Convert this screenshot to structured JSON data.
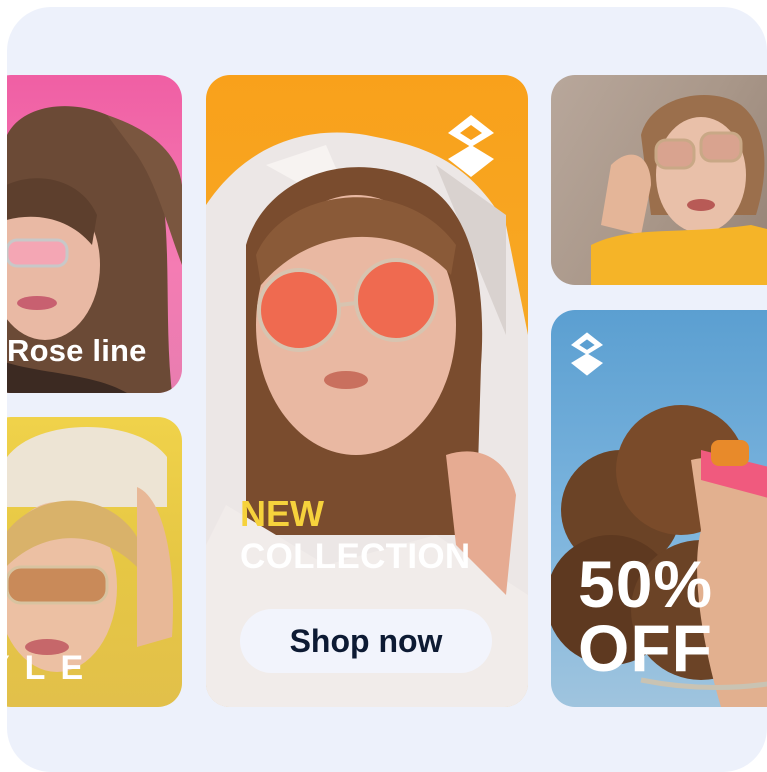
{
  "cards": [
    {
      "id": "rose",
      "label": "Rose line"
    },
    {
      "id": "collection",
      "new_text": "NEW",
      "collection_text": "COLLECTION",
      "button_label": "Shop now"
    },
    {
      "id": "model-top-right"
    },
    {
      "id": "sale",
      "percent_text": "50%",
      "off_text": "OFF"
    },
    {
      "id": "style",
      "label": "YLE"
    }
  ],
  "colors": {
    "background": "#edf1fb",
    "pink_card": "#f05fa4",
    "orange_card": "#f9a11b",
    "brown_card": "#a99789",
    "blue_card": "#5b9fd1",
    "yellow_card": "#f0d24a",
    "new_text": "#f6d23c",
    "button_bg": "#f2f4fc",
    "button_text": "#0d1a33"
  },
  "icons": [
    "diamond-logo-icon"
  ]
}
